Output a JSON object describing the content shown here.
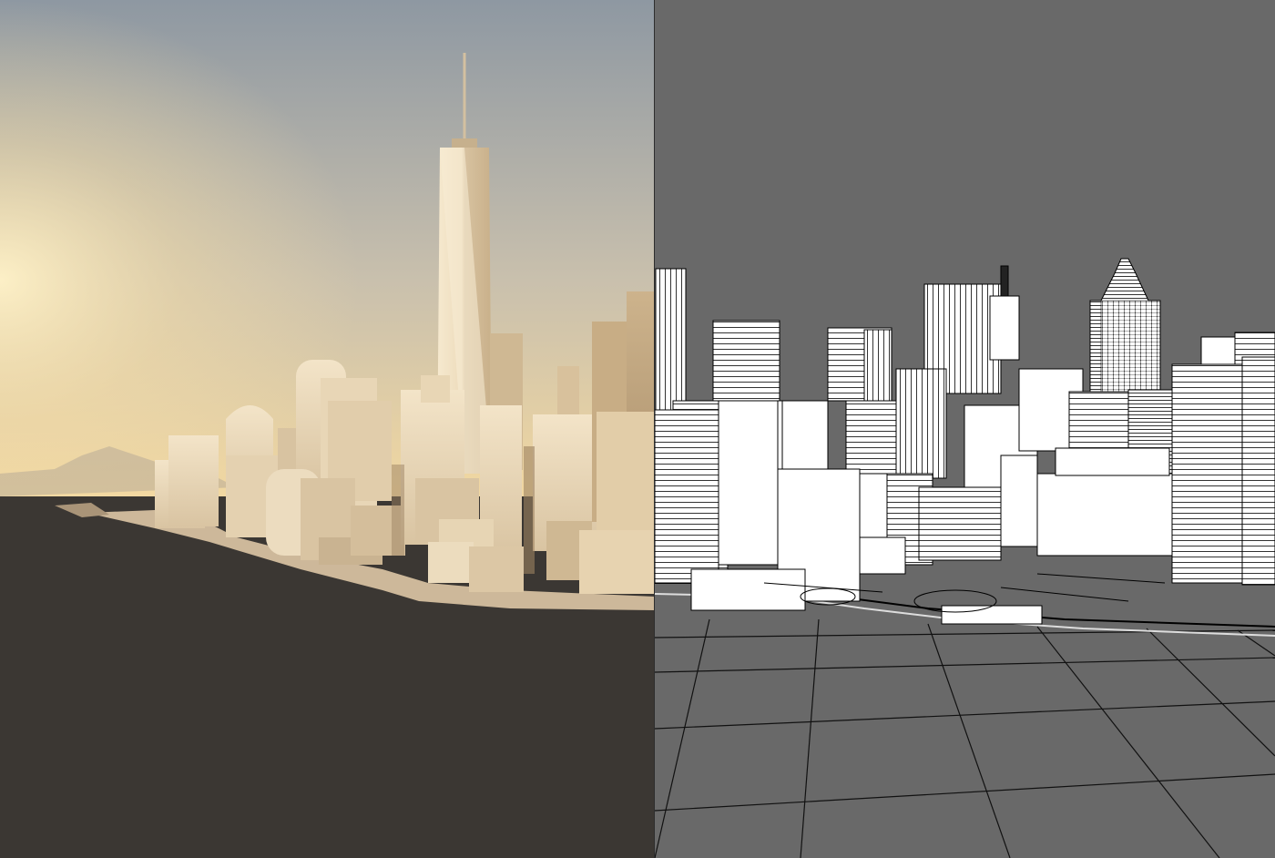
{
  "scene": {
    "render_view": {
      "sky_top_color": "#8e98a2",
      "sky_horizon_color": "#f4d9a0",
      "sun_glow_color": "#fff2c8",
      "ground_color": "#3b3733",
      "building_light_color": "#f1e2c6",
      "building_shadow_color": "#b79d78"
    },
    "wireframe_view": {
      "background_color": "#696969",
      "building_fill_color": "#ffffff",
      "line_color": "#000000",
      "grid_line_color": "#111111"
    },
    "divider_color": "#2e2e2e"
  }
}
